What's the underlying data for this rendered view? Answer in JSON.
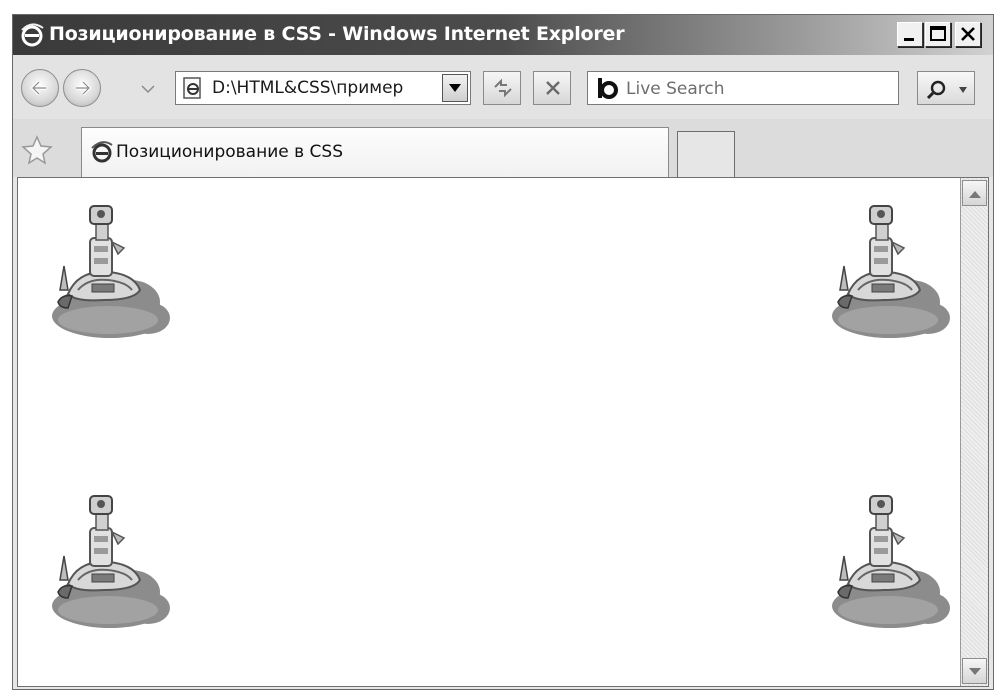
{
  "window": {
    "title": "Позиционирование в CSS - Windows Internet Explorer"
  },
  "navigation": {
    "address": "D:\\HTML&CSS\\пример",
    "search_placeholder": "Live Search"
  },
  "tabs": [
    {
      "label": "Позиционирование в CSS",
      "active": true
    }
  ],
  "content": {
    "images": [
      {
        "name": "robot-on-cloud",
        "corner": "top-left"
      },
      {
        "name": "robot-on-cloud",
        "corner": "top-right"
      },
      {
        "name": "robot-on-cloud",
        "corner": "bottom-left"
      },
      {
        "name": "robot-on-cloud",
        "corner": "bottom-right"
      }
    ]
  },
  "icons": {
    "title": "ie-logo-icon",
    "back": "back-arrow-icon",
    "forward": "forward-arrow-icon",
    "refresh": "refresh-icon",
    "stop": "stop-icon",
    "search_provider": "bing-logo-icon",
    "search": "magnifier-icon",
    "favorites": "star-icon"
  },
  "colors": {
    "titlebar": "#3a3a3a",
    "chrome": "#e3e3e3",
    "content_bg": "#ffffff",
    "cloud": "#8a8a8a"
  }
}
